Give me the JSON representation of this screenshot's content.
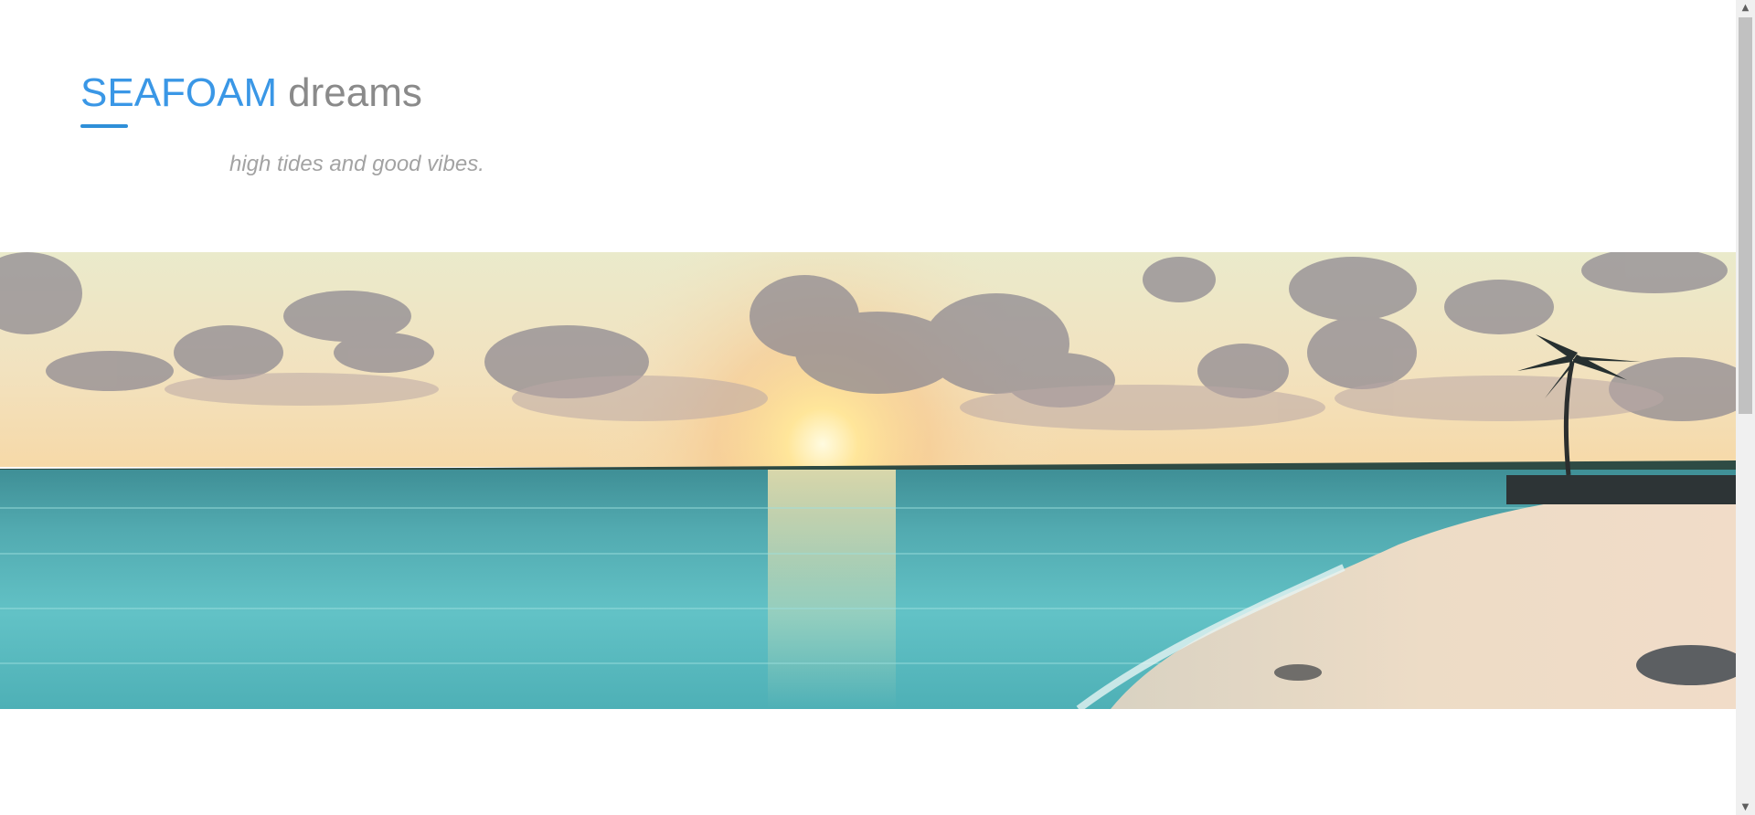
{
  "site": {
    "brand_primary": "SEAFOAM",
    "brand_secondary": "dreams",
    "tagline": "high tides and good vibes."
  },
  "hero": {
    "image_name": "beach-sunset-hero-image"
  },
  "colors": {
    "brand_blue": "#3a97e6",
    "brand_gray": "#8a8a8a",
    "tagline_gray": "#a3a3a3",
    "underline_blue": "#2e8fd8"
  },
  "scrollbar": {
    "up_icon": "chevron-up-icon",
    "down_icon": "chevron-down-icon"
  }
}
